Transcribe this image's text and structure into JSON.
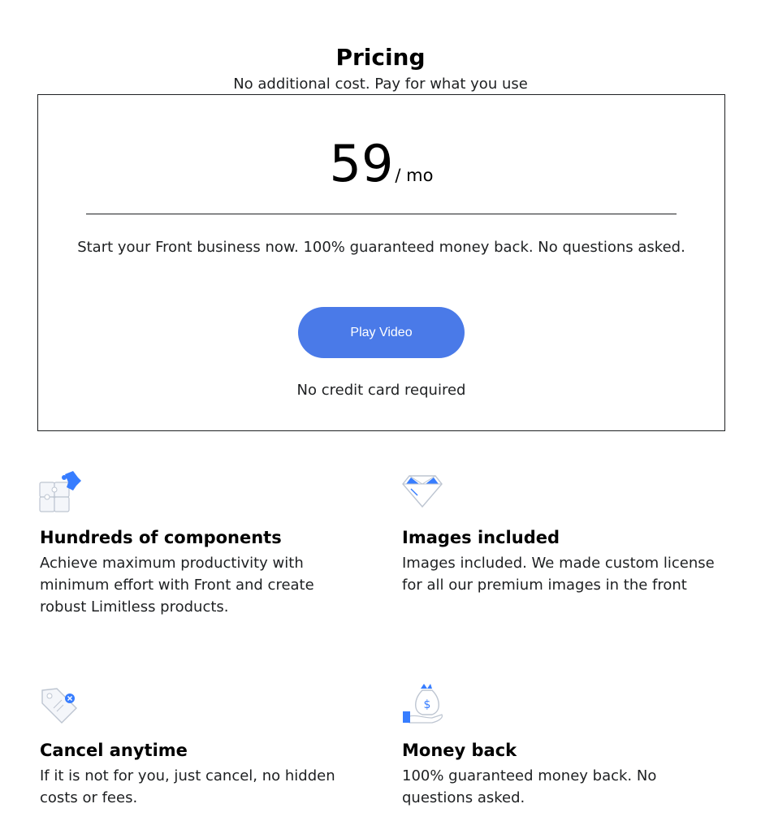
{
  "header": {
    "title": "Pricing",
    "subtitle": "No additional cost. Pay for what you use"
  },
  "pricing": {
    "price": "59",
    "period": "/ mo",
    "description": "Start your Front business now. 100% guaranteed money back. No questions asked.",
    "cta_label": "Play Video",
    "note": "No credit card required"
  },
  "features": [
    {
      "icon": "puzzle-icon",
      "title": "Hundreds of components",
      "text": "Achieve maximum productivity with minimum effort with Front and create robust Limitless products."
    },
    {
      "icon": "diamond-icon",
      "title": "Images included",
      "text": "Images included. We made custom license for all our premium images in the front"
    },
    {
      "icon": "price-tag-icon",
      "title": "Cancel anytime",
      "text": "If it is not for you, just cancel, no hidden costs or fees."
    },
    {
      "icon": "money-bag-icon",
      "title": "Money back",
      "text": "100% guaranteed money back. No questions asked."
    }
  ],
  "colors": {
    "accent": "#4a7ae8",
    "text": "#1e2022",
    "icon_light": "#bdc5d1"
  }
}
